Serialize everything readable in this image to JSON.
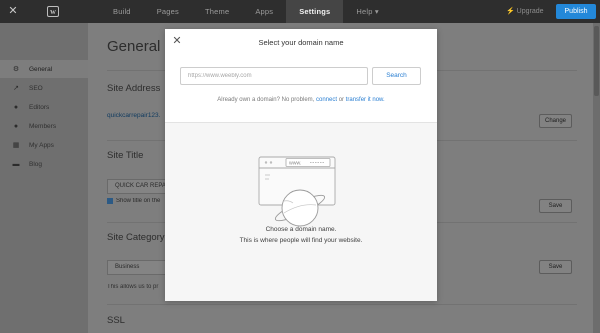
{
  "topbar": {
    "nav": [
      "Build",
      "Pages",
      "Theme",
      "Apps",
      "Settings",
      "Help ▾"
    ],
    "active_tab": "Settings",
    "upgrade": "⚡ Upgrade",
    "publish": "Publish",
    "colors": {
      "bar": "#2e2e2e",
      "publish": "#2388d9"
    }
  },
  "sidebar": {
    "items": [
      {
        "label": "General",
        "icon": "gear-icon"
      },
      {
        "label": "SEO",
        "icon": "trend-icon"
      },
      {
        "label": "Editors",
        "icon": "person-icon"
      },
      {
        "label": "Members",
        "icon": "members-icon"
      },
      {
        "label": "My Apps",
        "icon": "apps-grid-icon"
      },
      {
        "label": "Blog",
        "icon": "chat-bubble-icon"
      }
    ]
  },
  "main": {
    "title": "General",
    "site_address": {
      "heading": "Site Address",
      "value": "quickcarrepair123.",
      "button": "Change"
    },
    "site_title": {
      "heading": "Site Title",
      "value": "QUICK CAR REPAIR",
      "checkbox_label": "Show title on the",
      "button": "Save"
    },
    "site_category": {
      "heading": "Site Category",
      "value": "Business",
      "help": "This allows us to pr",
      "button": "Save"
    },
    "ssl": {
      "heading": "SSL"
    }
  },
  "modal": {
    "title": "Select your domain name",
    "close_icon": "close-icon",
    "search": {
      "placeholder": "https://www.weebly.com",
      "value": "",
      "button": "Search"
    },
    "own_domain": {
      "text": "Already own a domain? No problem,",
      "connect": "connect",
      "or": "or",
      "transfer": "transfer it now."
    },
    "illustration": {
      "url_text": "www."
    },
    "empty_state": {
      "line1": "Choose a domain name.",
      "line2": "This is where people will find your website."
    },
    "colors": {
      "link": "#2a7fd2"
    }
  }
}
